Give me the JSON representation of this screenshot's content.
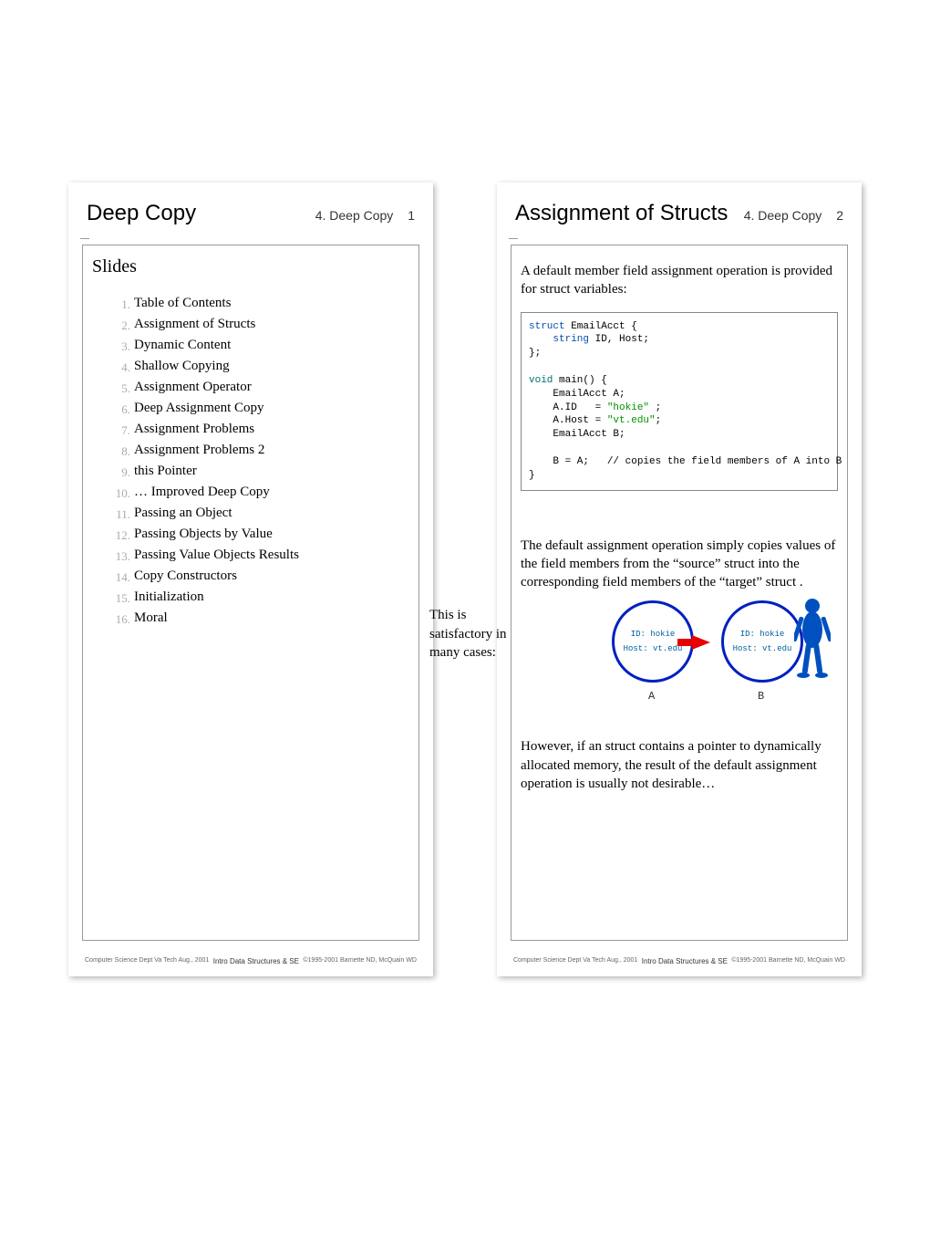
{
  "slide1": {
    "title": "Deep Copy",
    "section": "4. Deep Copy",
    "page": "1",
    "heading": "Slides",
    "toc": [
      "Table of Contents",
      "Assignment of Structs",
      "Dynamic Content",
      "Shallow Copying",
      "Assignment Operator",
      "Deep Assignment Copy",
      "Assignment Problems",
      "Assignment Problems 2",
      "this Pointer",
      "… Improved Deep Copy",
      "Passing an Object",
      "Passing Objects by Value",
      "Passing Value Objects Results",
      "Copy Constructors",
      "Initialization",
      "Moral"
    ]
  },
  "slide2": {
    "title": "Assignment of Structs",
    "section": "4. Deep Copy",
    "page": "2",
    "intro": "A default member field assignment operation is provided for struct variables:",
    "code": {
      "kw1": "struct",
      "name1": " EmailAcct {",
      "line2a": "    ",
      "kw2": "string",
      "line2b": " ID, Host;",
      "line3": "};",
      "blank1": "",
      "kw3": "void",
      "name3": " main() {",
      "line5": "    EmailAcct A;",
      "line6a": "    A.ID   = ",
      "str1": "\"hokie\"",
      "line6b": " ;",
      "line7a": "    A.Host = ",
      "str2": "\"vt.edu\"",
      "line7b": ";",
      "line8": "    EmailAcct B;",
      "blank2": "",
      "line9": "    B = A;   // copies the field members of A into B",
      "line10": "}"
    },
    "para1": "The default assignment operation simply copies values of the field members from the “source” struct into the corresponding field members of the “target” struct .",
    "sideText": "This is satisfactory in many cases:",
    "circleA_line1": "ID: hokie",
    "circleA_line2": "Host: vt.edu",
    "circleB_line1": "ID: hokie",
    "circleB_line2": "Host: vt.edu",
    "labelA": "A",
    "labelB": "B",
    "para2": "However, if an struct contains a pointer to dynamically allocated memory, the result of the default assignment operation is usually not desirable…"
  },
  "footer": {
    "left": "Computer Science Dept Va Tech Aug., 2001",
    "center": "Intro Data Structures & SE",
    "right": "©1995-2001 Barnette ND,  McQuain WD"
  }
}
